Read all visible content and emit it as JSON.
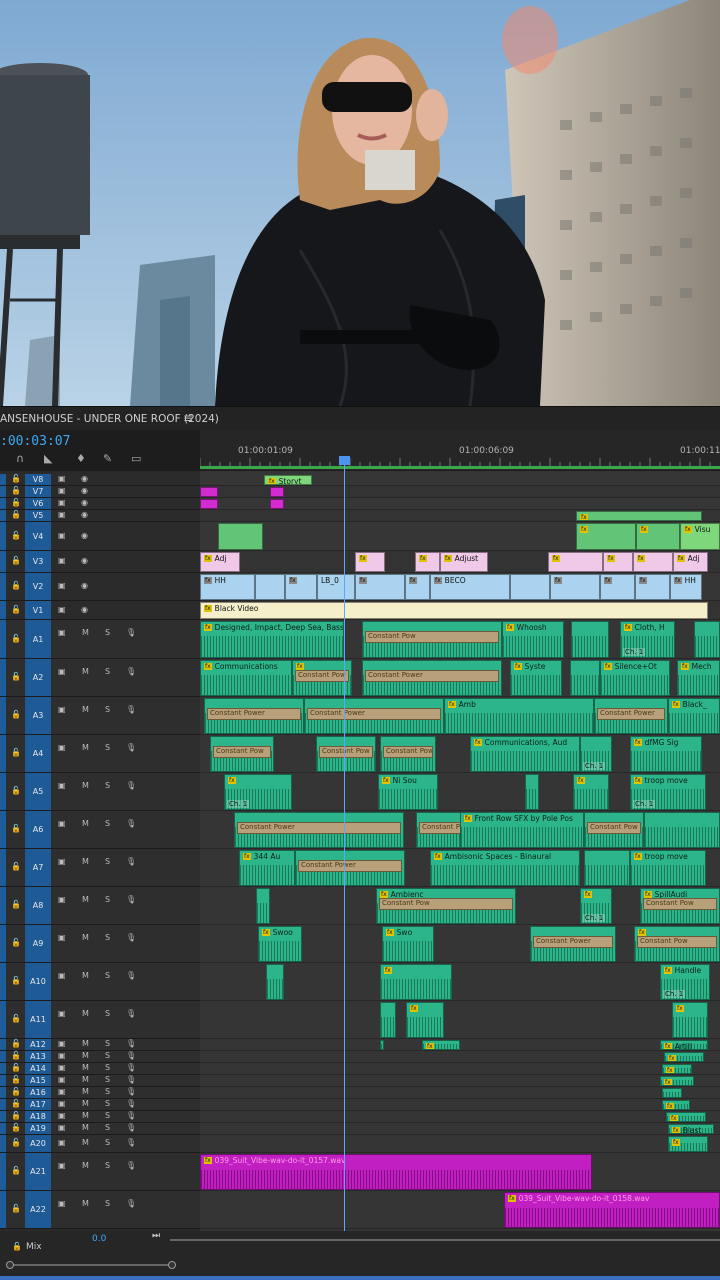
{
  "sequence": {
    "title": "ANSENHOUSE - UNDER ONE ROOF (2024)",
    "menu_icon": "hamburger-icon",
    "timecode": ":00:03:07"
  },
  "ruler": {
    "labels": [
      "01:00:01:09",
      "01:00:06:09",
      "01:00:11:0"
    ]
  },
  "tools": [
    "magnet-icon",
    "linked-selection-icon",
    "marker-icon",
    "wrench-icon",
    "captions-icon"
  ],
  "video_tracks": [
    {
      "name": "V8"
    },
    {
      "name": "V7"
    },
    {
      "name": "V6"
    },
    {
      "name": "V5"
    },
    {
      "name": "V4"
    },
    {
      "name": "V3"
    },
    {
      "name": "V2"
    },
    {
      "name": "V1"
    }
  ],
  "audio_tracks": [
    {
      "name": "A1"
    },
    {
      "name": "A2"
    },
    {
      "name": "A3"
    },
    {
      "name": "A4"
    },
    {
      "name": "A5"
    },
    {
      "name": "A6"
    },
    {
      "name": "A7"
    },
    {
      "name": "A8"
    },
    {
      "name": "A9"
    },
    {
      "name": "A10"
    },
    {
      "name": "A11"
    },
    {
      "name": "A12"
    },
    {
      "name": "A13"
    },
    {
      "name": "A14"
    },
    {
      "name": "A15"
    },
    {
      "name": "A16"
    },
    {
      "name": "A17"
    },
    {
      "name": "A18"
    },
    {
      "name": "A19"
    },
    {
      "name": "A20"
    },
    {
      "name": "A21"
    },
    {
      "name": "A22"
    }
  ],
  "track_buttons": {
    "mute": "M",
    "solo": "S"
  },
  "clip_labels": {
    "fx": "fx",
    "storyt": "Storyt",
    "adj": "Adj",
    "visu": "Visu",
    "adjust": "Adjust",
    "hh": "HH",
    "lb": "LB_0",
    "beco": "BECO",
    "black_video": "Black Video",
    "designed": "Designed, Impact, Deep Sea, Bass",
    "whoosh": "Whoosh",
    "cloth": "Cloth, H",
    "communications": "Communications",
    "syste": "Syste",
    "silence": "Silence+Ot",
    "mech": "Mech",
    "constant_power": "Constant Power",
    "constant_pow": "Constant Pow",
    "amb": "Amb",
    "black": "Black_",
    "comm_aud": "Communications, Aud",
    "dfmg": "dfMG Sig",
    "ni_sou": "Ni Sou",
    "troop_move": "troop move",
    "front_row": "Front Row SFX by Pole Pos",
    "au344": "344 Au",
    "ambisonic": "Ambisonic Spaces - Binaural",
    "ambienc": "Ambienc",
    "spill": "SpillAudi",
    "swoo": "Swoo",
    "swo": "Swo",
    "handle": "Handle",
    "artill": "Artill",
    "blast": "Blast",
    "ch1": "Ch. 1",
    "wav1": "039_Suit_Vibe-wav-do-it_0157.wav",
    "wav2": "039_Suit_Vibe-wav-do-it_0158.wav"
  },
  "mix": {
    "label": "Mix",
    "value": "0.0"
  }
}
